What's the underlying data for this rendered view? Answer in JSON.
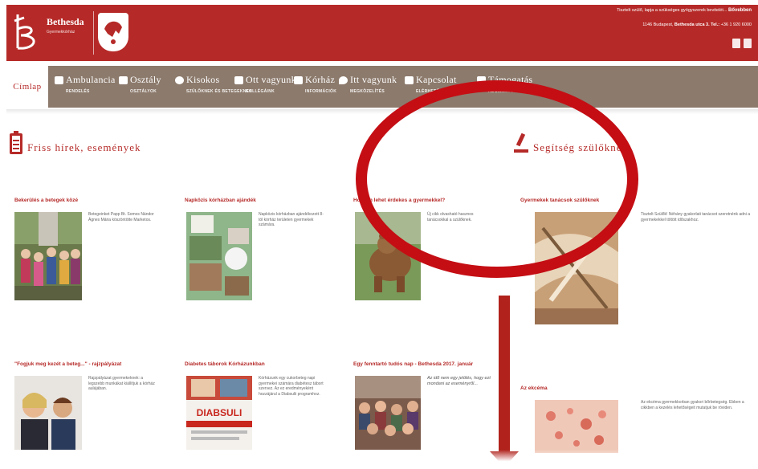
{
  "header": {
    "brand_name": "Bethesda",
    "brand_sub": "Gyermekkórház",
    "notice": "Tisztelt szülő, lapja a szükséges gyógyszerek bevitelét...",
    "notice_link": "Bővebben",
    "address_prefix": "1146 Budapest,",
    "address_street": "Bethesda utca 3.",
    "address_tel_label": "Tel.:",
    "address_tel": "+36 1 920 6000",
    "colors": {
      "brand": "#b52a28",
      "nav": "#8c7a6c"
    }
  },
  "nav": {
    "home": "Címlap",
    "items": [
      {
        "label": "Ambulancia",
        "sub": "RENDELÉS",
        "icon": "ambulance-icon"
      },
      {
        "label": "Osztály",
        "sub": "OSZTÁLYOK",
        "icon": "bed-icon"
      },
      {
        "label": "Kisokos",
        "sub": "SZÜLŐKNEK ÉS BETEGEKNEK",
        "icon": "question-icon"
      },
      {
        "label": "Ott vagyunk",
        "sub": "KOLLÉGÁINK",
        "icon": "people-icon"
      },
      {
        "label": "Kórház",
        "sub": "INFORMÁCIÓK",
        "icon": "building-icon"
      },
      {
        "label": "Itt vagyunk",
        "sub": "MEGKÖZELÍTÉS",
        "icon": "location-icon"
      },
      {
        "label": "Kapcsolat",
        "sub": "ELÉRHETŐSÉGEINK",
        "icon": "contact-icon"
      },
      {
        "label": "Támogatás",
        "sub": "ADOMÁNYOZÁS",
        "icon": "support-icon"
      }
    ]
  },
  "sections": {
    "news_title": "Friss hírek, események",
    "help_title": "Segítség szülőknek"
  },
  "news": [
    {
      "title": "Bekerülés a betegek közé",
      "text": "Betegeinket Papp Bt. Somos Nándor Ágnes Mária köszöntötte Marketos."
    },
    {
      "title": "Napközis kórházban ajándék",
      "text": "Napközis kórházban ajándékozott 8-tól kórház területen gyermekek számára."
    },
    {
      "title": "Hogyan lehet érdekes a gyermekkel?",
      "text": "Új cikk olvasható hasznos tanácsokkal a szülőknek."
    },
    {
      "title": "\"Fogjuk meg kezét a beteg...\" - rajzpályázat",
      "text": "Rajzpályázat gyermekeknek: a legszebb munkákat kiállítjuk a kórház aulájában."
    },
    {
      "title": "Diabetes táborok Kórházunkban",
      "text": "Kórházunk egy cukorbeteg napi gyermekei számára diabétesz tábort szervez. Az ez eredményeként hozzájárul a Diabsulii programhoz."
    },
    {
      "title": "Egy fenntartó tudós nap - Bethesda 2017. január",
      "text": "Az idő nem egy jelölés, hogy ezt mondani az eseményről..."
    }
  ],
  "news_images": {
    "image_5_caption": "DIABSULI"
  },
  "help": [
    {
      "title": "Gyermekek tanácsok szülőknek",
      "text": "Tisztelt Szülők! Néhány gyakorlati tanácsot szeretnénk adni a gyermekekkel töltött időszakhoz."
    },
    {
      "title": "Az ekcéma",
      "text": "Az ekcéma gyermekkorban gyakori bőrbetegség. Ebben a cikkben a kezelés lehetőségeit mutatjuk be röviden."
    }
  ],
  "annotations": {
    "oval_color": "#c40e14",
    "arrow_color": "#b0221b"
  }
}
